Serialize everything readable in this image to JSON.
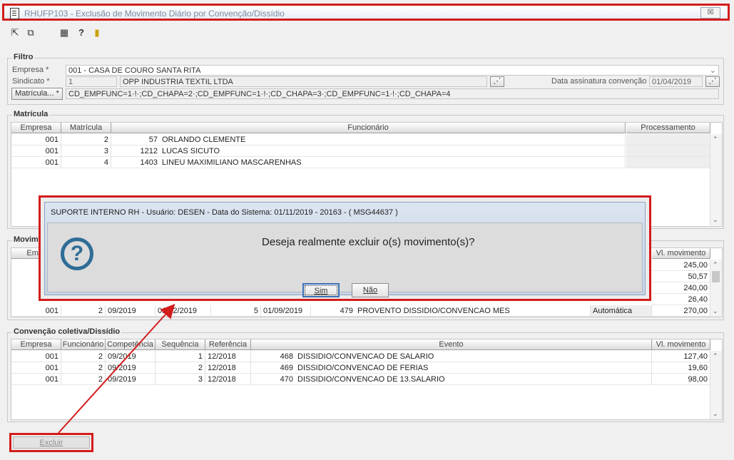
{
  "window": {
    "title": "RHUFP103 - Exclusão de Movimento Diário por Convenção/Dissídio",
    "close_label": "☒",
    "icons": [
      "doc-icon",
      "first-record-icon",
      "copy-icon",
      "calendar-icon",
      "help-icon",
      "exit-icon"
    ]
  },
  "filtro": {
    "legend": "Filtro",
    "empresa_label": "Empresa *",
    "empresa_value": "001 - CASA DE COURO SANTA RITA",
    "sindicato_label": "Sindicato *",
    "sindicato_code": "1",
    "sindicato_name": "OPP INDUSTRIA TEXTIL LTDA",
    "data_label": "Data assinatura convenção",
    "data_value": "01/04/2019",
    "matricula_button": "Matrícula... *",
    "matricula_value": "CD_EMPFUNC=1·!·;CD_CHAPA=2·;CD_EMPFUNC=1·!·;CD_CHAPA=3·;CD_EMPFUNC=1·!·;CD_CHAPA=4"
  },
  "matricula": {
    "legend": "Matrícula",
    "headers": [
      "Empresa",
      "Matrícula",
      "Funcionário",
      "Processamento"
    ],
    "rows": [
      {
        "empresa": "001",
        "matricula": "2",
        "codigo": "57",
        "nome": "ORLANDO CLEMENTE"
      },
      {
        "empresa": "001",
        "matricula": "3",
        "codigo": "1212",
        "nome": "LUCAS SICUTO"
      },
      {
        "empresa": "001",
        "matricula": "4",
        "codigo": "1403",
        "nome": "LINEU MAXIMILIANO MASCARENHAS"
      }
    ]
  },
  "movimento": {
    "legend": "Movim",
    "header_partial": "Empr",
    "header_valor": "Vl. movimento",
    "valores": [
      "245,00",
      "50,57",
      "240,00",
      "26,40"
    ],
    "last_row": {
      "empresa": "001",
      "funcionario": "2",
      "competencia": "09/2019",
      "data": "01/12/2019",
      "sequencia": "5",
      "referencia": "01/09/2019",
      "codigo": "479",
      "evento": "PROVENTO DISSIDIO/CONVENCAO MES",
      "tipo": "Automática",
      "valor": "270,00"
    }
  },
  "convencao": {
    "legend": "Convenção coletiva/Dissídio",
    "headers": [
      "Empresa",
      "Funcionário",
      "Competência",
      "Sequência",
      "Referência",
      "Evento",
      "Vl. movimento"
    ],
    "rows": [
      {
        "empresa": "001",
        "funcionario": "2",
        "competencia": "09/2019",
        "sequencia": "1",
        "referencia": "12/2018",
        "codigo": "468",
        "evento": "DISSIDIO/CONVENCAO DE SALARIO",
        "valor": "127,40"
      },
      {
        "empresa": "001",
        "funcionario": "2",
        "competencia": "09/2019",
        "sequencia": "2",
        "referencia": "12/2018",
        "codigo": "469",
        "evento": "DISSIDIO/CONVENCAO DE FERIAS",
        "valor": "19,60"
      },
      {
        "empresa": "001",
        "funcionario": "2",
        "competencia": "09/2019",
        "sequencia": "3",
        "referencia": "12/2018",
        "codigo": "470",
        "evento": "DISSIDIO/CONVENCAO DE 13.SALARIO",
        "valor": "98,00"
      }
    ]
  },
  "dialog": {
    "title": "SUPORTE INTERNO RH - Usuário: DESEN - Data do Sistema: 01/11/2019 - 20163 - ( MSG44637 )",
    "message": "Deseja realmente excluir o(s) movimento(s)?",
    "yes_label": "Sim",
    "no_label": "Não"
  },
  "footer": {
    "excluir_label": "Excluir"
  },
  "colors": {
    "highlight": "#d31c1c",
    "question_icon": "#2e6d96"
  }
}
